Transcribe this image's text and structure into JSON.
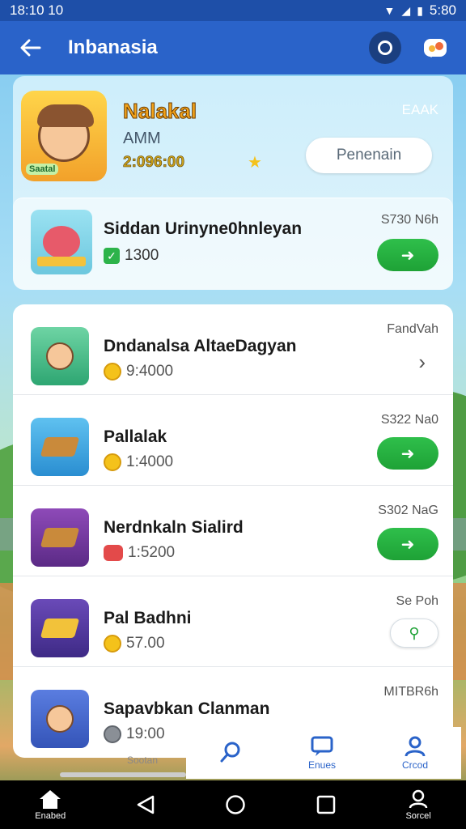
{
  "status_bar": {
    "time": "18:10 10",
    "clock": "5:80"
  },
  "app_bar": {
    "title": "Inbanasia"
  },
  "profile": {
    "name": "Nalakal",
    "subtitle": "AMM",
    "score": "2:096:00",
    "tag": "EAAK",
    "button_label": "Penenain",
    "avatar_badge": "Saatal"
  },
  "featured": {
    "title": "Siddan Urinyne0hnleyan",
    "value": "1300",
    "price": "S730 N6h"
  },
  "items": [
    {
      "title": "Dndanalsa AltaeDagyan",
      "value": "9:4000",
      "price": "FandVah",
      "action": "chevron"
    },
    {
      "title": "Pallalak",
      "value": "1:4000",
      "price": "S322 Na0",
      "action": "green"
    },
    {
      "title": "Nerdnkaln Sialird",
      "value": "1:5200",
      "price": "S302 NaG",
      "action": "green"
    },
    {
      "title": "Pal Badhni",
      "value": "57.00",
      "price": "Se Poh",
      "action": "white"
    },
    {
      "title": "Sapavbkan Clanman",
      "value": "19:00",
      "price": "MITBR6h",
      "action": "green"
    }
  ],
  "tabs": {
    "left_label": "Sootan",
    "t1": "",
    "t2": "Enues",
    "t3": "Crcod"
  },
  "nav": {
    "home_label": "Enabed",
    "profile_label": "Sorcel"
  },
  "colors": {
    "primary": "#2a63c9",
    "green": "#1ea236"
  }
}
